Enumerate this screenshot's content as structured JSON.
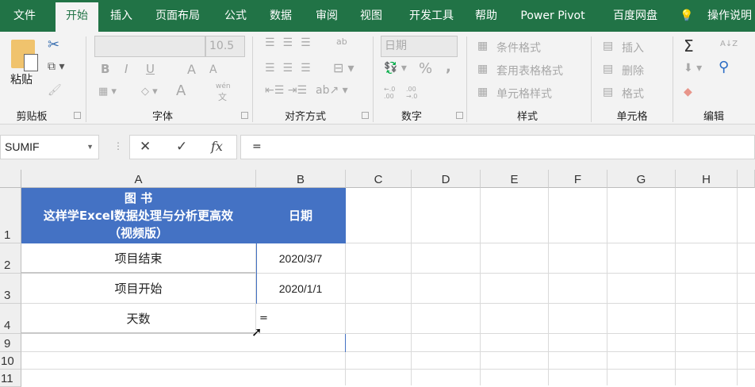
{
  "tabs": [
    "文件",
    "开始",
    "插入",
    "页面布局",
    "公式",
    "数据",
    "审阅",
    "视图",
    "开发工具",
    "帮助",
    "Power Pivot",
    "百度网盘",
    "操作说明"
  ],
  "ribbon": {
    "clipboard": {
      "paste": "粘贴",
      "label": "剪贴板"
    },
    "font": {
      "font_name": "",
      "font_size": "10.5",
      "bold": "B",
      "italic": "I",
      "underline": "U",
      "grow": "A",
      "shrink": "A",
      "color": "A",
      "phonetic": "wén",
      "phonetic_char": "文",
      "label": "字体"
    },
    "alignment": {
      "label": "对齐方式",
      "wrap": "ab"
    },
    "number": {
      "format": "日期",
      "percent": "%",
      "comma": ",",
      "inc": "←.0 .00",
      "dec": ".00 →.0",
      "label": "数字"
    },
    "styles": {
      "conditional": "条件格式",
      "table": "套用表格格式",
      "cell": "单元格样式",
      "label": "样式"
    },
    "cells": {
      "insert": "插入",
      "delete": "删除",
      "format": "格式",
      "label": "单元格"
    },
    "editing": {
      "sum": "Σ",
      "sort": "A↓Z",
      "find": "⚲",
      "label": "编辑"
    }
  },
  "formula_bar": {
    "name_box": "SUMIF",
    "cancel": "✕",
    "enter": "✓",
    "fx": "fx",
    "content": "="
  },
  "columns": [
    "A",
    "B",
    "C",
    "D",
    "E",
    "F",
    "G",
    "H"
  ],
  "rows": [
    "1",
    "2",
    "3",
    "4",
    "9",
    "10",
    "11"
  ],
  "cells": {
    "A1": [
      "图 书",
      "这样学Excel数据处理与分析更高效",
      "（视频版）"
    ],
    "B1": "日期",
    "A2": "项目结束",
    "B2": "2020/3/7",
    "A3": "项目开始",
    "B3": "2020/1/1",
    "A4": "天数",
    "B4": "="
  },
  "colors": {
    "excel_green": "#217346",
    "header_blue": "#4472c4"
  }
}
